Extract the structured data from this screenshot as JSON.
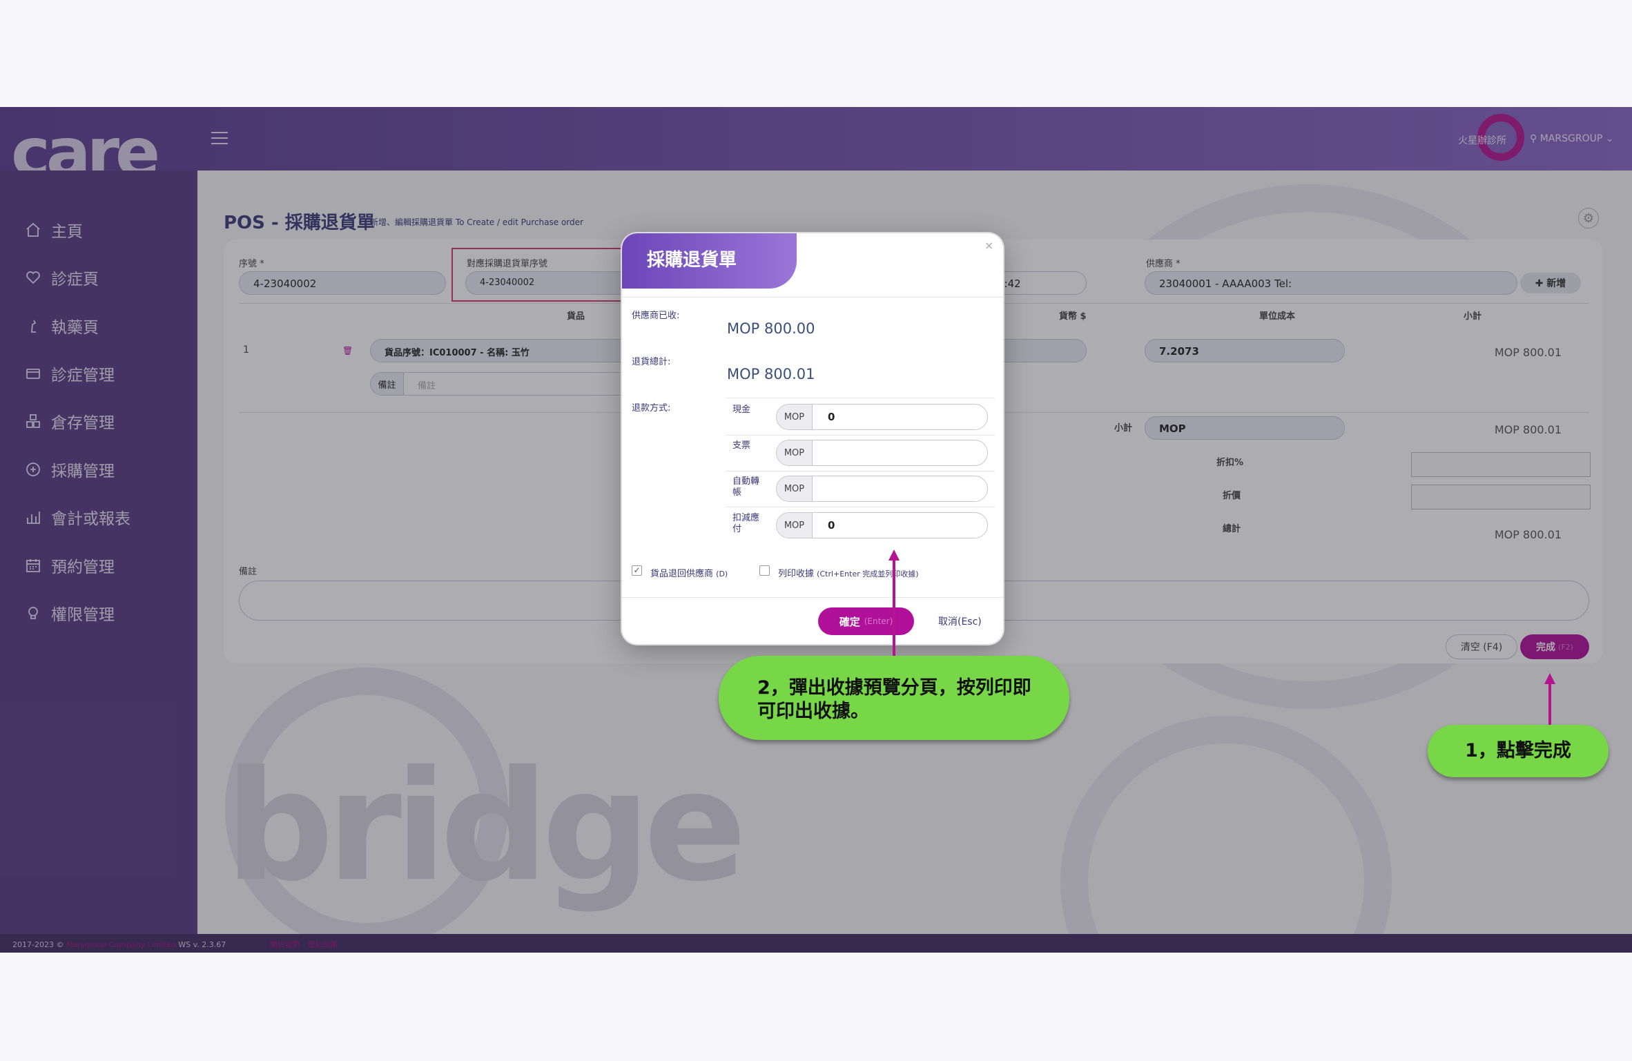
{
  "app": {
    "logo_text": "care",
    "clinic_name": "火星辦診所",
    "user_name": "MARSGROUP ⌄"
  },
  "sidebar": {
    "items": [
      {
        "label": "主頁",
        "icon": "home-icon"
      },
      {
        "label": "診症頁",
        "icon": "heart-icon"
      },
      {
        "label": "執藥頁",
        "icon": "chess-piece-icon"
      },
      {
        "label": "診症管理",
        "icon": "card-icon"
      },
      {
        "label": "倉存管理",
        "icon": "boxes-icon"
      },
      {
        "label": "採購管理",
        "icon": "plus-circle-icon"
      },
      {
        "label": "會計或報表",
        "icon": "bar-chart-icon"
      },
      {
        "label": "預約管理",
        "icon": "calendar-icon"
      },
      {
        "label": "權限管理",
        "icon": "bulb-icon"
      }
    ]
  },
  "page": {
    "title": "POS - 採購退貨單",
    "subtitle": "新增、編輯採購退貨單 To Create / edit Purchase order",
    "settings_icon": "⚙"
  },
  "form": {
    "serial_label": "序號 *",
    "serial_value": "4-23040002",
    "po_serial_label": "對應採購退貨單序號",
    "po_serial_value": "4-23040002",
    "date_value_partial": "8:42",
    "supplier_label": "供應商 *",
    "supplier_value": "23040001 - AAAA003 Tel:",
    "add_supplier_label": "✚ 新增",
    "columns": {
      "goods": "貨品",
      "currency": "貨幣 $",
      "unit_cost": "單位成本",
      "subtotal": "小計"
    },
    "row": {
      "index": "1",
      "item_text": "貨品序號：IC010007 - 名稱: 玉竹",
      "remark_label": "備註",
      "remark_placeholder": "備註",
      "unit_cost": "7.2073",
      "subtotal": "MOP 800.01"
    },
    "subtotal_label": "小計",
    "subtotal_currency": "MOP",
    "subtotal_value": "MOP 800.01",
    "discount_pct_label": "折扣%",
    "discount_label": "折價",
    "total_label": "總計",
    "total_value": "MOP 800.01",
    "note_label": "備註",
    "clear_label": "清空 (F4)",
    "done_label": "完成",
    "done_hint": "(F2)"
  },
  "modal": {
    "title": "採購退貨單",
    "close_glyph": "×",
    "received_label": "供應商已收:",
    "received_value": "MOP 800.00",
    "return_total_label": "退貨總計:",
    "return_total_value": "MOP 800.01",
    "payment_method_label": "退款方式:",
    "payments": [
      {
        "label": "現金",
        "currency": "MOP",
        "value": "0"
      },
      {
        "label": "支票",
        "currency": "MOP",
        "value": ""
      },
      {
        "label": "自動轉帳",
        "currency": "MOP",
        "value": ""
      },
      {
        "label": "扣減應付",
        "currency": "MOP",
        "value": "0"
      }
    ],
    "return_goods_label": "貨品退回供應商",
    "return_goods_hint": "(D)",
    "return_goods_checked": true,
    "print_receipt_label": "列印收據",
    "print_receipt_hint": "(Ctrl+Enter 完成並列印收據)",
    "print_receipt_checked": false,
    "confirm_label": "確定",
    "confirm_hint": "(Enter)",
    "cancel_label": "取消(Esc)"
  },
  "footer": {
    "copyright": "2017-2023 ©",
    "company": "Marsgroup Company Limited",
    "version": "WS v. 2.3.67",
    "links": "關於我們 · 隱私政策"
  },
  "callouts": {
    "step1": "1，點擊完成",
    "step2": "2，彈出收據預覽分頁，按列印即可印出收據。"
  },
  "colors": {
    "brand_purple": "#6c46b8",
    "accent_magenta": "#b0109a",
    "callout_green": "#77d747"
  }
}
